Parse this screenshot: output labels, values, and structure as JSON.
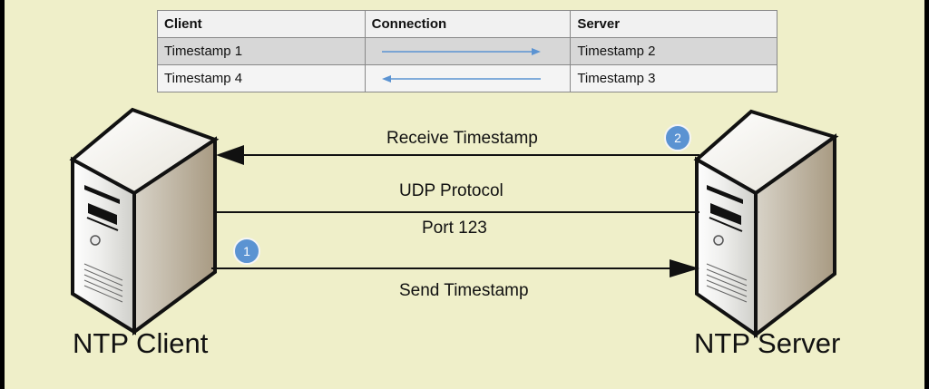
{
  "table": {
    "headers": [
      "Client",
      "Connection",
      "Server"
    ],
    "rows": [
      {
        "client": "Timestamp 1",
        "direction": "right",
        "server": "Timestamp 2"
      },
      {
        "client": "Timestamp 4",
        "direction": "left",
        "server": "Timestamp 3"
      }
    ]
  },
  "diagram": {
    "receive_label": "Receive Timestamp",
    "udp_label": "UDP Protocol",
    "port_label": "Port 123",
    "send_label": "Send Timestamp",
    "client_label": "NTP Client",
    "server_label": "NTP Server",
    "badge_1": "1",
    "badge_2": "2"
  },
  "colors": {
    "background": "#efefc9",
    "accent": "#5b93d2",
    "arrow": "#111111"
  }
}
